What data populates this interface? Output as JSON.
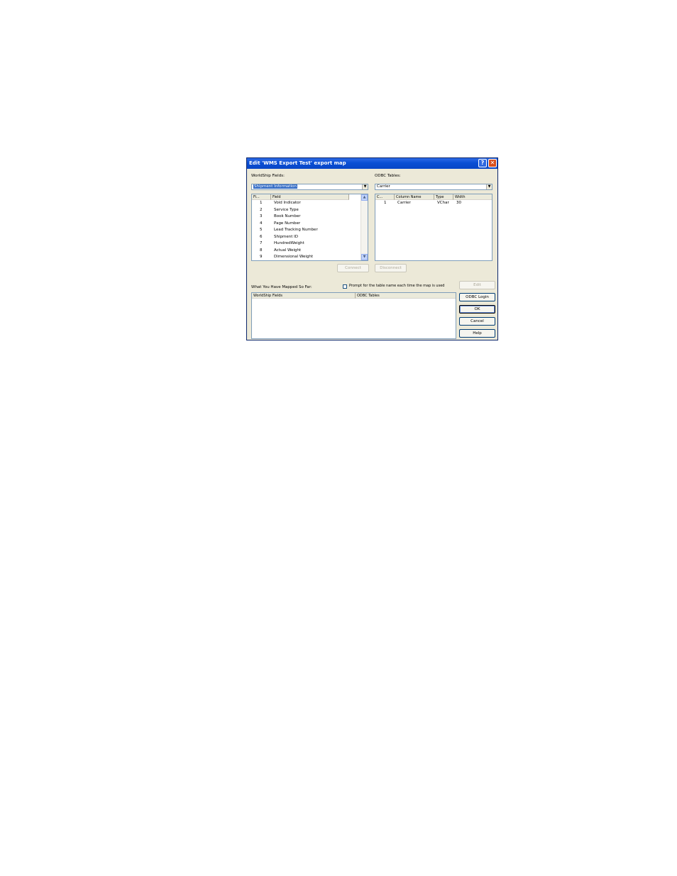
{
  "dialog": {
    "title": "Edit 'WMS Export Test' export map",
    "help_glyph": "?",
    "close_glyph": "✕"
  },
  "worldship": {
    "label": "WorldShip Fields:",
    "combo_value": "Shipment Information",
    "columns": [
      "Fi...",
      "Field"
    ],
    "rows": [
      {
        "num": "1",
        "field": "Void Indicator"
      },
      {
        "num": "2",
        "field": "Service Type"
      },
      {
        "num": "3",
        "field": "Book Number"
      },
      {
        "num": "4",
        "field": "Page Number"
      },
      {
        "num": "5",
        "field": "Lead Tracking Number"
      },
      {
        "num": "6",
        "field": "Shipment ID"
      },
      {
        "num": "7",
        "field": "HundredWeight"
      },
      {
        "num": "8",
        "field": "Actual Weight"
      },
      {
        "num": "9",
        "field": "Dimensional Weight"
      }
    ]
  },
  "odbc": {
    "label": "ODBC Tables:",
    "combo_value": "Carrier",
    "columns": [
      "C...",
      "Column Name",
      "Type",
      "Width"
    ],
    "rows": [
      {
        "num": "1",
        "name": "Carrier",
        "type": "VChar",
        "width": "30"
      }
    ]
  },
  "buttons": {
    "connect": "Connect",
    "disconnect": "Disconnect",
    "edit": "Edit",
    "odbc_login": "ODBC Login",
    "ok": "OK",
    "cancel": "Cancel",
    "help": "Help"
  },
  "mapped": {
    "label": "What You Have Mapped So Far:",
    "prompt_checkbox": "Prompt for the table name each time the map is used",
    "columns": [
      "WorldShip Fields",
      "ODBC Tables"
    ]
  }
}
